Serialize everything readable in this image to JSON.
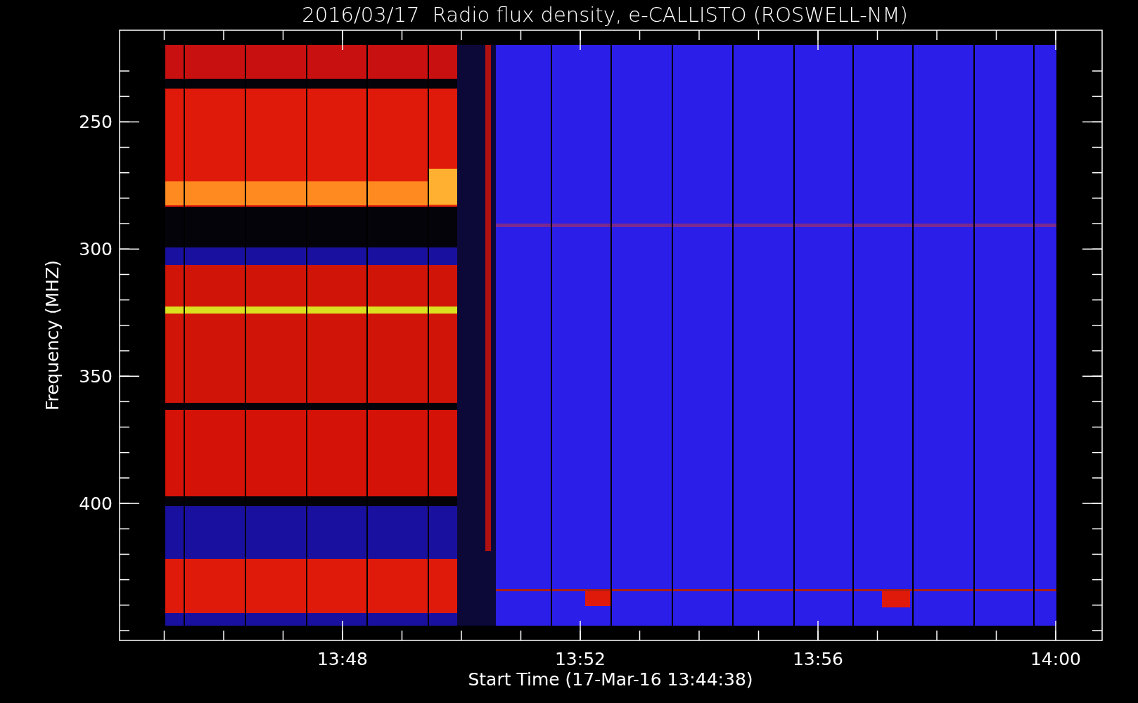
{
  "title": "2016/03/17  Radio flux density, e-CALLISTO (ROSWELL-NM)",
  "y_axis": {
    "label": "Frequency (MHZ)",
    "tick_labels": [
      "250",
      "300",
      "350",
      "400"
    ]
  },
  "x_axis": {
    "label": "Start Time (17-Mar-16 13:44:38)",
    "tick_labels": [
      "13:48",
      "13:52",
      "13:56",
      "14:00"
    ]
  }
}
